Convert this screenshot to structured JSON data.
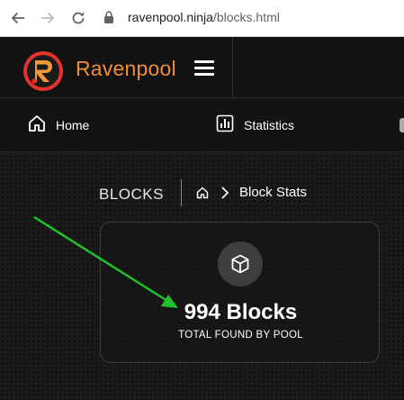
{
  "browser": {
    "url_domain": "ravenpool.ninja",
    "url_path": "/blocks.html"
  },
  "header": {
    "logo_icon": "ravenpool-logo",
    "brand": "Ravenpool",
    "menu_icon": "hamburger-icon"
  },
  "menu": {
    "items": [
      {
        "label": "Home",
        "icon": "home-icon"
      },
      {
        "label": "Statistics",
        "icon": "bar-chart-icon"
      }
    ]
  },
  "breadcrumb": {
    "title": "BLOCKS",
    "current": "Block Stats"
  },
  "card": {
    "icon": "cube-icon",
    "value": "994 Blocks",
    "label": "TOTAL FOUND BY POOL"
  },
  "colors": {
    "brand": "#ee8e3a",
    "logo_red": "#e4332a",
    "annotation_arrow": "#1ec32b"
  }
}
